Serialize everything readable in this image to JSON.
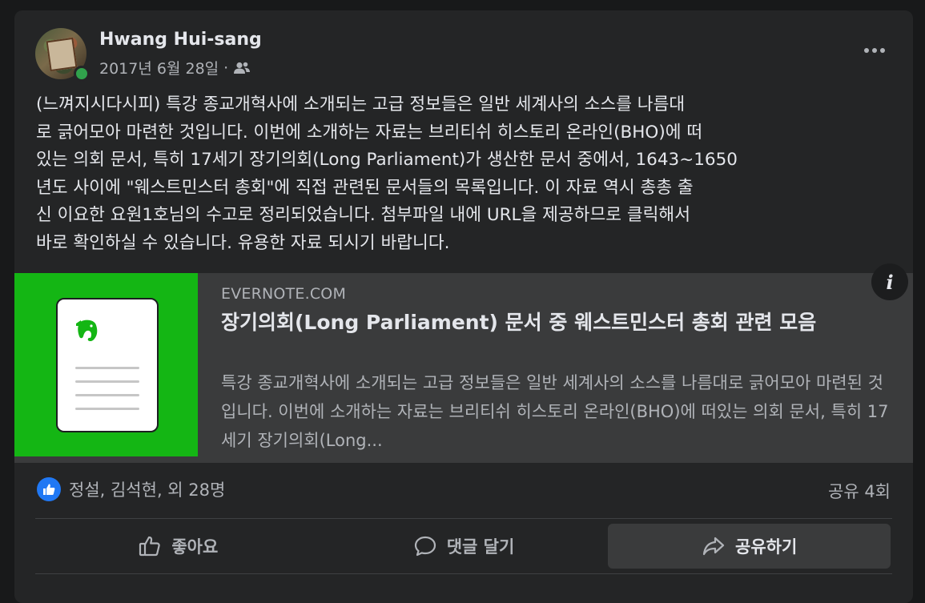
{
  "post": {
    "author": "Hwang Hui-sang",
    "date": "2017년 6월 28일",
    "separator": "·",
    "audience_icon": "friends-icon",
    "text": "(느껴지시다시피) 특강 종교개혁사에 소개되는 고급 정보들은 일반 세계사의 소스를 나름대\n로 긁어모아 마련한 것입니다. 이번에 소개하는 자료는 브리티쉬 히스토리 온라인(BHO)에 떠\n있는 의회 문서, 특히 17세기 장기의회(Long Parliament)가 생산한 문서 중에서, 1643~1650\n년도 사이에 \"웨스트민스터 총회\"에 직접 관련된 문서들의 목록입니다. 이 자료 역시 총총 출\n신 이요한 요원1호님의 수고로 정리되었습니다. 첨부파일 내에 URL을 제공하므로 클릭해서\n바로 확인하실 수 있습니다. 유용한 자료 되시기 바랍니다."
  },
  "link_preview": {
    "domain": "EVERNOTE.COM",
    "title": "장기의회(Long Parliament) 문서 중 웨스트민스터 총회 관련 모음",
    "description": "특강 종교개혁사에 소개되는 고급 정보들은 일반 세계사의 소스를 나름대로 긁어모아 마련된 것입니다. 이번에 소개하는 자료는 브리티쉬 히스토리 온라인(BHO)에 떠있는 의회 문서, 특히 17세기 장기의회(Long...",
    "info_label": "i",
    "thumb_color": "#14b614"
  },
  "engagement": {
    "reactions_text": "정설, 김석현, 외 28명",
    "shares_text": "공유 4회"
  },
  "actions": {
    "like": "좋아요",
    "comment": "댓글 달기",
    "share": "공유하기"
  },
  "colors": {
    "background": "#18191a",
    "card": "#242526",
    "like_blue": "#2078f4",
    "online_green": "#31a24c"
  }
}
